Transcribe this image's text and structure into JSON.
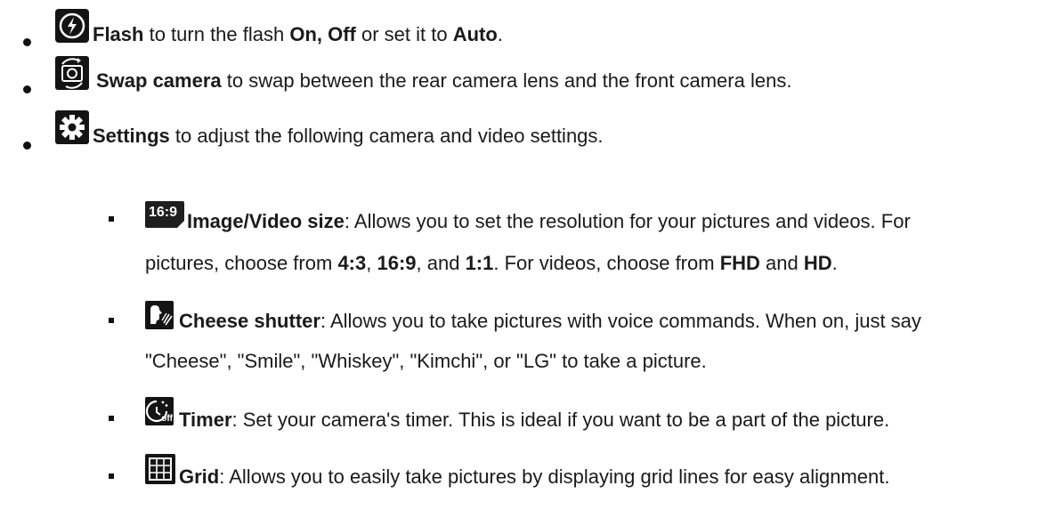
{
  "items": [
    {
      "icon": "flash-icon",
      "label": "Flash",
      "t1": " to turn the flash ",
      "b1": "On, Off",
      "t2": " or set it to ",
      "b2": "Auto",
      "t3": "."
    },
    {
      "icon": "swap-camera-icon",
      "label": "Swap camera",
      "t1": " to swap between the rear camera lens and the front camera lens."
    },
    {
      "icon": "settings-gear-icon",
      "label": "Settings",
      "t1": " to adjust the following camera and video settings."
    }
  ],
  "subitems": [
    {
      "icon": "image-size-icon",
      "icon_text": "16:9",
      "label": "Image/Video size",
      "line1": ": Allows you to set the resolution for your pictures and videos. For",
      "line2_pre": "pictures, choose from ",
      "b1": "4:3",
      "sep1": ", ",
      "b2": "16:9",
      "sep2": ", and ",
      "b3": "1:1",
      "mid": ". For videos, choose from ",
      "b4": "FHD",
      "sep3": " and ",
      "b5": "HD",
      "end": "."
    },
    {
      "icon": "cheese-shutter-icon",
      "label": "Cheese shutter",
      "line1": ": Allows you to take pictures with voice commands. When on, just say",
      "line2": "\"Cheese\", \"Smile\", \"Whiskey\", \"Kimchi\", or \"LG\" to take a picture."
    },
    {
      "icon": "timer-icon",
      "icon_text": "off",
      "label": "Timer",
      "line1": ": Set your camera's timer. This is ideal if you want to be a part of the picture."
    },
    {
      "icon": "grid-icon",
      "label": "Grid",
      "line1": ": Allows you to easily take pictures by displaying grid lines for easy alignment."
    }
  ]
}
